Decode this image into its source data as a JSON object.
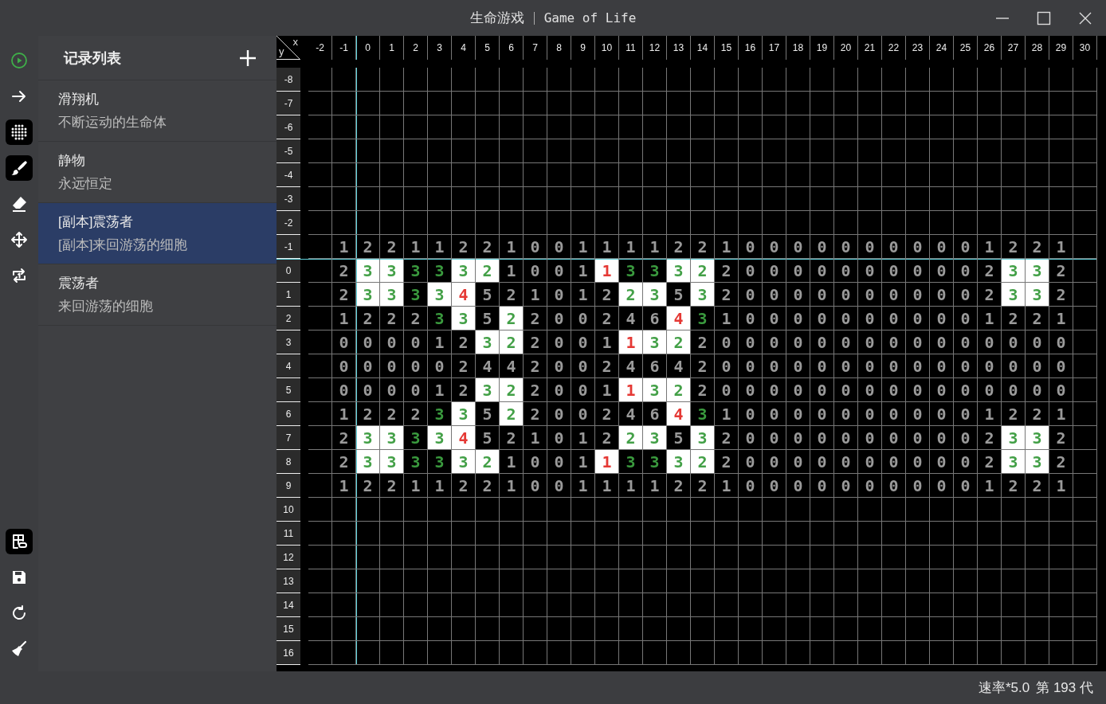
{
  "window": {
    "title": "生命游戏",
    "subtitle": "Game of Life"
  },
  "toolbar": {
    "top": [
      {
        "selected": false
      },
      {
        "selected": false
      },
      {
        "selected": true
      },
      {
        "selected": true
      },
      {
        "selected": false
      },
      {
        "selected": false
      },
      {
        "selected": false
      }
    ],
    "bottom": [
      {
        "selected": true
      },
      {
        "selected": false
      },
      {
        "selected": false
      },
      {
        "selected": false
      }
    ]
  },
  "records": {
    "title": "记录列表",
    "items": [
      {
        "title": "滑翔机",
        "subtitle": "不断运动的生命体",
        "selected": false
      },
      {
        "title": "静物",
        "subtitle": "永远恒定",
        "selected": false
      },
      {
        "title": "[副本]震荡者",
        "subtitle": "[副本]来回游荡的细胞",
        "selected": true
      },
      {
        "title": "震荡者",
        "subtitle": "来回游荡的细胞",
        "selected": false
      }
    ]
  },
  "grid": {
    "corner_x": "x",
    "corner_y": "y",
    "columns": [
      {
        "label": "-2",
        "axis": false
      },
      {
        "label": "-1",
        "axis": false
      },
      {
        "label": "0",
        "axis": true
      },
      {
        "label": "1",
        "axis": false
      },
      {
        "label": "2",
        "axis": false
      },
      {
        "label": "3",
        "axis": false
      },
      {
        "label": "4",
        "axis": false
      },
      {
        "label": "5",
        "axis": false
      },
      {
        "label": "6",
        "axis": false
      },
      {
        "label": "7",
        "axis": false
      },
      {
        "label": "8",
        "axis": false
      },
      {
        "label": "9",
        "axis": false
      },
      {
        "label": "10",
        "axis": false
      },
      {
        "label": "11",
        "axis": false
      },
      {
        "label": "12",
        "axis": false
      },
      {
        "label": "13",
        "axis": false
      },
      {
        "label": "14",
        "axis": false
      },
      {
        "label": "15",
        "axis": false
      },
      {
        "label": "16",
        "axis": false
      },
      {
        "label": "17",
        "axis": false
      },
      {
        "label": "18",
        "axis": false
      },
      {
        "label": "19",
        "axis": false
      },
      {
        "label": "20",
        "axis": false
      },
      {
        "label": "21",
        "axis": false
      },
      {
        "label": "22",
        "axis": false
      },
      {
        "label": "23",
        "axis": false
      },
      {
        "label": "24",
        "axis": false
      },
      {
        "label": "25",
        "axis": false
      },
      {
        "label": "26",
        "axis": false
      },
      {
        "label": "27",
        "axis": false
      },
      {
        "label": "28",
        "axis": false
      },
      {
        "label": "29",
        "axis": false
      },
      {
        "label": "30",
        "axis": false
      }
    ],
    "rows": [
      {
        "label": "-8",
        "axis": false
      },
      {
        "label": "-7",
        "axis": false
      },
      {
        "label": "-6",
        "axis": false
      },
      {
        "label": "-5",
        "axis": false
      },
      {
        "label": "-4",
        "axis": false
      },
      {
        "label": "-3",
        "axis": false
      },
      {
        "label": "-2",
        "axis": false
      },
      {
        "label": "-1",
        "axis": false,
        "counts": [
          "1",
          "2",
          "2",
          "1",
          "1",
          "2",
          "2",
          "1",
          "0",
          "0",
          "1",
          "1",
          "1",
          "1",
          "2",
          "2",
          "1",
          "0",
          "0",
          "0",
          "0",
          "0",
          "0",
          "0",
          "0",
          "0",
          "0",
          "1",
          "2",
          "2",
          "1"
        ],
        "alive": [
          false,
          false,
          false,
          false,
          false,
          false,
          false,
          false,
          false,
          false,
          false,
          false,
          false,
          false,
          false,
          false,
          false,
          false,
          false,
          false,
          false,
          false,
          false,
          false,
          false,
          false,
          false,
          false,
          false,
          false,
          false
        ]
      },
      {
        "label": "0",
        "axis": true,
        "counts": [
          "2",
          "3",
          "3",
          "3",
          "3",
          "3",
          "2",
          "1",
          "0",
          "0",
          "1",
          "1",
          "3",
          "3",
          "3",
          "2",
          "2",
          "0",
          "0",
          "0",
          "0",
          "0",
          "0",
          "0",
          "0",
          "0",
          "0",
          "2",
          "3",
          "3",
          "2"
        ],
        "alive": [
          false,
          true,
          true,
          false,
          false,
          true,
          true,
          false,
          false,
          false,
          false,
          true,
          false,
          false,
          true,
          true,
          false,
          false,
          false,
          false,
          false,
          false,
          false,
          false,
          false,
          false,
          false,
          false,
          true,
          true,
          false
        ]
      },
      {
        "label": "1",
        "axis": false,
        "counts": [
          "2",
          "3",
          "3",
          "3",
          "3",
          "4",
          "5",
          "2",
          "1",
          "0",
          "1",
          "2",
          "2",
          "3",
          "5",
          "3",
          "2",
          "0",
          "0",
          "0",
          "0",
          "0",
          "0",
          "0",
          "0",
          "0",
          "0",
          "2",
          "3",
          "3",
          "2"
        ],
        "alive": [
          false,
          true,
          true,
          false,
          true,
          true,
          false,
          false,
          false,
          false,
          false,
          false,
          true,
          true,
          false,
          true,
          false,
          false,
          false,
          false,
          false,
          false,
          false,
          false,
          false,
          false,
          false,
          false,
          true,
          true,
          false
        ]
      },
      {
        "label": "2",
        "axis": false,
        "counts": [
          "1",
          "2",
          "2",
          "2",
          "3",
          "3",
          "5",
          "2",
          "2",
          "0",
          "0",
          "2",
          "4",
          "6",
          "4",
          "3",
          "1",
          "0",
          "0",
          "0",
          "0",
          "0",
          "0",
          "0",
          "0",
          "0",
          "0",
          "1",
          "2",
          "2",
          "1"
        ],
        "alive": [
          false,
          false,
          false,
          false,
          false,
          true,
          false,
          true,
          false,
          false,
          false,
          false,
          false,
          false,
          true,
          false,
          false,
          false,
          false,
          false,
          false,
          false,
          false,
          false,
          false,
          false,
          false,
          false,
          false,
          false,
          false
        ]
      },
      {
        "label": "3",
        "axis": false,
        "counts": [
          "0",
          "0",
          "0",
          "0",
          "1",
          "2",
          "3",
          "2",
          "2",
          "0",
          "0",
          "1",
          "1",
          "3",
          "2",
          "2",
          "0",
          "0",
          "0",
          "0",
          "0",
          "0",
          "0",
          "0",
          "0",
          "0",
          "0",
          "0",
          "0",
          "0",
          "0"
        ],
        "alive": [
          false,
          false,
          false,
          false,
          false,
          false,
          true,
          true,
          false,
          false,
          false,
          false,
          true,
          true,
          true,
          false,
          false,
          false,
          false,
          false,
          false,
          false,
          false,
          false,
          false,
          false,
          false,
          false,
          false,
          false,
          false
        ]
      },
      {
        "label": "4",
        "axis": false,
        "counts": [
          "0",
          "0",
          "0",
          "0",
          "0",
          "2",
          "4",
          "4",
          "2",
          "0",
          "0",
          "2",
          "4",
          "6",
          "4",
          "2",
          "0",
          "0",
          "0",
          "0",
          "0",
          "0",
          "0",
          "0",
          "0",
          "0",
          "0",
          "0",
          "0",
          "0",
          "0"
        ],
        "alive": [
          false,
          false,
          false,
          false,
          false,
          false,
          false,
          false,
          false,
          false,
          false,
          false,
          false,
          false,
          false,
          false,
          false,
          false,
          false,
          false,
          false,
          false,
          false,
          false,
          false,
          false,
          false,
          false,
          false,
          false,
          false
        ]
      },
      {
        "label": "5",
        "axis": false,
        "counts": [
          "0",
          "0",
          "0",
          "0",
          "1",
          "2",
          "3",
          "2",
          "2",
          "0",
          "0",
          "1",
          "1",
          "3",
          "2",
          "2",
          "0",
          "0",
          "0",
          "0",
          "0",
          "0",
          "0",
          "0",
          "0",
          "0",
          "0",
          "0",
          "0",
          "0",
          "0"
        ],
        "alive": [
          false,
          false,
          false,
          false,
          false,
          false,
          true,
          true,
          false,
          false,
          false,
          false,
          true,
          true,
          true,
          false,
          false,
          false,
          false,
          false,
          false,
          false,
          false,
          false,
          false,
          false,
          false,
          false,
          false,
          false,
          false
        ]
      },
      {
        "label": "6",
        "axis": false,
        "counts": [
          "1",
          "2",
          "2",
          "2",
          "3",
          "3",
          "5",
          "2",
          "2",
          "0",
          "0",
          "2",
          "4",
          "6",
          "4",
          "3",
          "1",
          "0",
          "0",
          "0",
          "0",
          "0",
          "0",
          "0",
          "0",
          "0",
          "0",
          "1",
          "2",
          "2",
          "1"
        ],
        "alive": [
          false,
          false,
          false,
          false,
          false,
          true,
          false,
          true,
          false,
          false,
          false,
          false,
          false,
          false,
          true,
          false,
          false,
          false,
          false,
          false,
          false,
          false,
          false,
          false,
          false,
          false,
          false,
          false,
          false,
          false,
          false
        ]
      },
      {
        "label": "7",
        "axis": false,
        "counts": [
          "2",
          "3",
          "3",
          "3",
          "3",
          "4",
          "5",
          "2",
          "1",
          "0",
          "1",
          "2",
          "2",
          "3",
          "5",
          "3",
          "2",
          "0",
          "0",
          "0",
          "0",
          "0",
          "0",
          "0",
          "0",
          "0",
          "0",
          "2",
          "3",
          "3",
          "2"
        ],
        "alive": [
          false,
          true,
          true,
          false,
          true,
          true,
          false,
          false,
          false,
          false,
          false,
          false,
          true,
          true,
          false,
          true,
          false,
          false,
          false,
          false,
          false,
          false,
          false,
          false,
          false,
          false,
          false,
          false,
          true,
          true,
          false
        ]
      },
      {
        "label": "8",
        "axis": false,
        "counts": [
          "2",
          "3",
          "3",
          "3",
          "3",
          "3",
          "2",
          "1",
          "0",
          "0",
          "1",
          "1",
          "3",
          "3",
          "3",
          "2",
          "2",
          "0",
          "0",
          "0",
          "0",
          "0",
          "0",
          "0",
          "0",
          "0",
          "0",
          "2",
          "3",
          "3",
          "2"
        ],
        "alive": [
          false,
          true,
          true,
          false,
          false,
          true,
          true,
          false,
          false,
          false,
          false,
          true,
          false,
          false,
          true,
          true,
          false,
          false,
          false,
          false,
          false,
          false,
          false,
          false,
          false,
          false,
          false,
          false,
          true,
          true,
          false
        ]
      },
      {
        "label": "9",
        "axis": false,
        "counts": [
          "1",
          "2",
          "2",
          "1",
          "1",
          "2",
          "2",
          "1",
          "0",
          "0",
          "1",
          "1",
          "1",
          "1",
          "2",
          "2",
          "1",
          "0",
          "0",
          "0",
          "0",
          "0",
          "0",
          "0",
          "0",
          "0",
          "0",
          "1",
          "2",
          "2",
          "1"
        ],
        "alive": [
          false,
          false,
          false,
          false,
          false,
          false,
          false,
          false,
          false,
          false,
          false,
          false,
          false,
          false,
          false,
          false,
          false,
          false,
          false,
          false,
          false,
          false,
          false,
          false,
          false,
          false,
          false,
          false,
          false,
          false,
          false
        ]
      },
      {
        "label": "10",
        "axis": false
      },
      {
        "label": "11",
        "axis": false
      },
      {
        "label": "12",
        "axis": false
      },
      {
        "label": "13",
        "axis": false
      },
      {
        "label": "14",
        "axis": false
      },
      {
        "label": "15",
        "axis": false
      },
      {
        "label": "16",
        "axis": false
      }
    ]
  },
  "status": {
    "speed": "速率*5.0",
    "generation": "第 193 代"
  }
}
